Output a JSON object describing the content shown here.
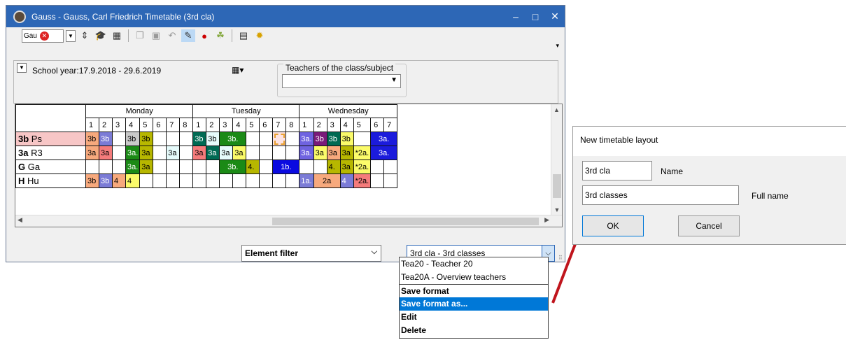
{
  "window": {
    "title": "Gauss - Gauss, Carl Friedrich  Timetable  (3rd cla)",
    "minimize": "–",
    "maximize": "□",
    "close": "✕"
  },
  "toolbar": {
    "element_combo_value": "Gau",
    "element_clear": "✕"
  },
  "info": {
    "school_year": "School year:17.9.2018 - 29.6.2019",
    "teachers_label": "Teachers of the class/subject",
    "teachers_value": ""
  },
  "grid": {
    "days": [
      "Monday",
      "Tuesday",
      "Wednesday"
    ],
    "periods": [
      [
        "1",
        "2",
        "3",
        "4",
        "5",
        "6",
        "7",
        "8"
      ],
      [
        "1",
        "2",
        "3",
        "4",
        "5",
        "6",
        "7",
        "8"
      ],
      [
        "1",
        "2",
        "3",
        "4",
        "5",
        "6",
        "7"
      ]
    ],
    "rows": [
      {
        "code": "3b",
        "name": "Ps",
        "bg": "#f7c6c6"
      },
      {
        "code": "3a",
        "name": "R3",
        "bg": "#ffffff"
      },
      {
        "code": "G",
        "name": "Ga",
        "bg": "#ffffff"
      },
      {
        "code": "H",
        "name": "Hu",
        "bg": "#ffffff"
      }
    ],
    "cells": [
      [
        [
          {
            "t": "3b",
            "bg": "#f7a97d",
            "span": 1
          },
          {
            "t": "3b",
            "bg": "#7b7bd6",
            "fg": "#fff",
            "span": 1
          },
          {
            "t": "",
            "bg": "",
            "span": 1
          },
          {
            "t": "3b",
            "bg": "#c9c9c9",
            "span": 1
          },
          {
            "t": "3b",
            "bg": "#b7b700",
            "span": 1
          },
          {
            "t": "",
            "bg": "",
            "span": 1
          },
          {
            "t": "",
            "bg": "",
            "span": 1
          },
          {
            "t": "",
            "bg": "",
            "span": 1
          }
        ],
        [
          {
            "t": "3b",
            "bg": "#006a53",
            "fg": "#fff",
            "span": 1
          },
          {
            "t": "3b",
            "bg": "#e6fbfb",
            "span": 1
          },
          {
            "t": "3b.",
            "bg": "#1b8a16",
            "fg": "#fff",
            "span": 2
          },
          {
            "t": "",
            "bg": "",
            "span": 1
          },
          {
            "t": "",
            "bg": "",
            "span": 1
          },
          {
            "t": "",
            "bg": "#fde3e3",
            "dashed": true,
            "span": 1
          },
          {
            "t": "",
            "bg": "",
            "span": 1
          }
        ],
        [
          {
            "t": "3a.",
            "bg": "#6f63e0",
            "fg": "#fff",
            "span": 1
          },
          {
            "t": "3b",
            "bg": "#7a1a7a",
            "fg": "#fff",
            "span": 1
          },
          {
            "t": "3b",
            "bg": "#006a53",
            "fg": "#fff",
            "span": 1
          },
          {
            "t": "3b",
            "bg": "#fbfb6a",
            "span": 1
          },
          {
            "t": "",
            "bg": "",
            "span": 1
          },
          {
            "t": "3a.",
            "bg": "#1b1bdc",
            "fg": "#fff",
            "span": 2
          }
        ]
      ],
      [
        [
          {
            "t": "3a",
            "bg": "#f7a97d",
            "span": 1
          },
          {
            "t": "3a",
            "bg": "#f57b7b",
            "span": 1
          },
          {
            "t": "",
            "bg": "",
            "span": 1
          },
          {
            "t": "3a.",
            "bg": "#1b8a16",
            "fg": "#fff",
            "span": 1
          },
          {
            "t": "3a",
            "bg": "#b7b700",
            "span": 1
          },
          {
            "t": "",
            "bg": "",
            "span": 1
          },
          {
            "t": "3a",
            "bg": "#e6fbfb",
            "span": 1
          },
          {
            "t": "",
            "bg": "",
            "span": 1
          }
        ],
        [
          {
            "t": "3a",
            "bg": "#f57b7b",
            "span": 1
          },
          {
            "t": "3a",
            "bg": "#006a53",
            "fg": "#fff",
            "span": 1
          },
          {
            "t": "3a",
            "bg": "#e6fbfb",
            "span": 1
          },
          {
            "t": "3a",
            "bg": "#fbfb6a",
            "span": 1
          },
          {
            "t": "",
            "bg": "",
            "span": 1
          },
          {
            "t": "",
            "bg": "",
            "span": 1
          },
          {
            "t": "",
            "bg": "",
            "span": 1
          },
          {
            "t": "",
            "bg": "",
            "span": 1
          }
        ],
        [
          {
            "t": "3a.",
            "bg": "#6f63e0",
            "fg": "#fff",
            "span": 1
          },
          {
            "t": "3a",
            "bg": "#fbfb6a",
            "span": 1
          },
          {
            "t": "3a",
            "bg": "#f7a97d",
            "span": 1
          },
          {
            "t": "3a",
            "bg": "#b7b700",
            "span": 1
          },
          {
            "t": "*2a.",
            "bg": "#fbfb6a",
            "span": 1
          },
          {
            "t": "3a.",
            "bg": "#1b1bdc",
            "fg": "#fff",
            "span": 2
          }
        ]
      ],
      [
        [
          {
            "t": "",
            "bg": "",
            "span": 1
          },
          {
            "t": "",
            "bg": "",
            "span": 1
          },
          {
            "t": "",
            "bg": "",
            "span": 1
          },
          {
            "t": "3a.",
            "bg": "#1b8a16",
            "fg": "#fff",
            "span": 1
          },
          {
            "t": "3a",
            "bg": "#b7b700",
            "span": 1
          },
          {
            "t": "",
            "bg": "",
            "span": 1
          },
          {
            "t": "",
            "bg": "",
            "span": 1
          },
          {
            "t": "",
            "bg": "",
            "span": 1
          }
        ],
        [
          {
            "t": "",
            "bg": "",
            "span": 1
          },
          {
            "t": "",
            "bg": "",
            "span": 1
          },
          {
            "t": "3b.",
            "bg": "#1b8a16",
            "fg": "#fff",
            "span": 2
          },
          {
            "t": "4.",
            "bg": "#b7b700",
            "span": 1
          },
          {
            "t": "",
            "bg": "",
            "span": 1
          },
          {
            "t": "1b.",
            "bg": "#0a0ae0",
            "fg": "#fff",
            "span": 2
          }
        ],
        [
          {
            "t": "",
            "bg": "",
            "span": 1
          },
          {
            "t": "",
            "bg": "",
            "span": 1
          },
          {
            "t": "4.",
            "bg": "#b7b700",
            "span": 1
          },
          {
            "t": "3a",
            "bg": "#b7b700",
            "span": 1
          },
          {
            "t": "*2a.",
            "bg": "#fbfb6a",
            "span": 1
          },
          {
            "t": "",
            "bg": "",
            "span": 1
          },
          {
            "t": "",
            "bg": "",
            "span": 1
          }
        ]
      ],
      [
        [
          {
            "t": "3b",
            "bg": "#f7a97d",
            "span": 1
          },
          {
            "t": "3b",
            "bg": "#7b7bd6",
            "fg": "#fff",
            "span": 1
          },
          {
            "t": "4",
            "bg": "#f7a97d",
            "span": 1
          },
          {
            "t": "4",
            "bg": "#fbfb6a",
            "span": 1
          },
          {
            "t": "",
            "bg": "",
            "span": 1
          },
          {
            "t": "",
            "bg": "",
            "span": 1
          },
          {
            "t": "",
            "bg": "",
            "span": 1
          },
          {
            "t": "",
            "bg": "",
            "span": 1
          }
        ],
        [
          {
            "t": "",
            "bg": "",
            "span": 1
          },
          {
            "t": "",
            "bg": "",
            "span": 1
          },
          {
            "t": "",
            "bg": "",
            "span": 1
          },
          {
            "t": "",
            "bg": "",
            "span": 1
          },
          {
            "t": "",
            "bg": "",
            "span": 1
          },
          {
            "t": "",
            "bg": "",
            "span": 1
          },
          {
            "t": "",
            "bg": "",
            "span": 1
          },
          {
            "t": "",
            "bg": "",
            "span": 1
          }
        ],
        [
          {
            "t": "1a.",
            "bg": "#7b7bd6",
            "fg": "#fff",
            "span": 1
          },
          {
            "t": "2a",
            "bg": "#f7a97d",
            "span": 2
          },
          {
            "t": "4",
            "bg": "#7b7bd6",
            "fg": "#fff",
            "span": 1
          },
          {
            "t": "*2a.",
            "bg": "#f57b7b",
            "span": 1
          },
          {
            "t": "",
            "bg": "",
            "span": 1
          },
          {
            "t": "",
            "bg": "",
            "span": 1
          }
        ]
      ]
    ]
  },
  "filters": {
    "element_filter": "Element filter",
    "format_value": "3rd cla - 3rd classes"
  },
  "dropdown": {
    "items": [
      {
        "label": "Tea20 - Teacher 20",
        "bold": false,
        "selected": false,
        "sep": false
      },
      {
        "label": "Tea20A - Overview teachers",
        "bold": false,
        "selected": false,
        "sep": false
      },
      {
        "label": "Save format",
        "bold": true,
        "selected": false,
        "sep": true
      },
      {
        "label": "Save format as...",
        "bold": true,
        "selected": true,
        "sep": false
      },
      {
        "label": "Edit",
        "bold": true,
        "selected": false,
        "sep": false
      },
      {
        "label": "Delete",
        "bold": true,
        "selected": false,
        "sep": false
      }
    ]
  },
  "dialog": {
    "title": "New timetable layout",
    "name_value": "3rd cla",
    "name_label": "Name",
    "fullname_value": "3rd classes",
    "fullname_label": "Full name",
    "ok": "OK",
    "cancel": "Cancel"
  },
  "arrow_color": "#c0151d"
}
